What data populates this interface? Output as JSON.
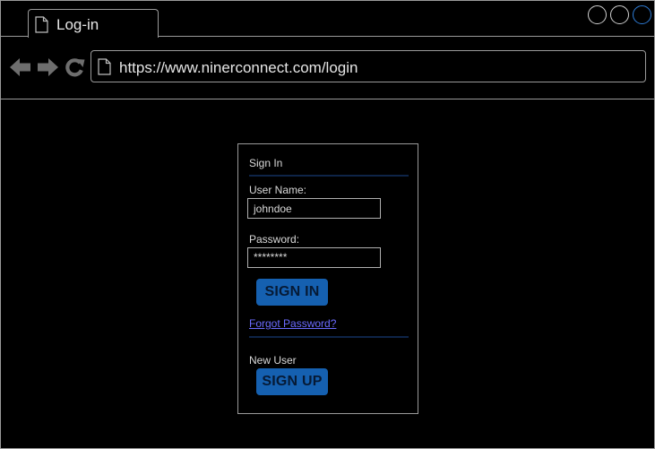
{
  "browser": {
    "tab_title": "Log-in",
    "url": "https://www.ninerconnect.com/login",
    "icons": {
      "tab_page": "document-icon",
      "back": "arrow-left-icon",
      "forward": "arrow-right-icon",
      "reload": "reload-icon",
      "url_page": "document-icon"
    },
    "window_controls": [
      "minimize",
      "maximize",
      "close"
    ]
  },
  "login": {
    "heading": "Sign In",
    "username_label": "User Name:",
    "username_value": "johndoe",
    "password_label": "Password:",
    "password_value": "********",
    "signin_button": "SIGN IN",
    "forgot_link": "Forgot Password?",
    "new_user_label": "New User",
    "signup_button": "SIGN UP"
  },
  "colors": {
    "background": "#000000",
    "border": "#9a9a9a",
    "button": "#1560b0",
    "button_text": "#061a35",
    "link": "#6b6bff",
    "close_control": "#2e7cd6",
    "divider": "#0e2448"
  }
}
